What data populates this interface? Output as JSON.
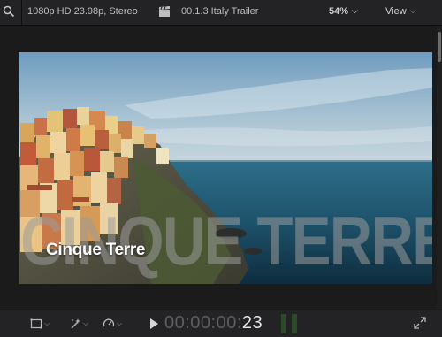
{
  "viewer": {
    "format": "1080p HD 23.98p, Stereo",
    "clip_name": "00.1.3  Italy Trailer",
    "zoom": "54%",
    "view_label": "View"
  },
  "video": {
    "title_overlay": "Cinque Terre",
    "big_overlay": "CINQUE TERRE"
  },
  "transport": {
    "timecode_dim": "00:00:00:",
    "timecode_frames": "23"
  },
  "icons": {
    "search": "search-icon",
    "clapper": "clapperboard-icon",
    "transform": "transform-icon",
    "enhance": "magic-wand-icon",
    "speed": "speedometer-icon",
    "play": "play-icon",
    "fullscreen": "fullscreen-icon"
  },
  "colors": {
    "background": "#1b1b1c",
    "bar": "#232325",
    "timecode_dim": "#5e5e60",
    "timecode_lit": "#e6e6e6",
    "audio_meter": "#2d4a2a"
  }
}
